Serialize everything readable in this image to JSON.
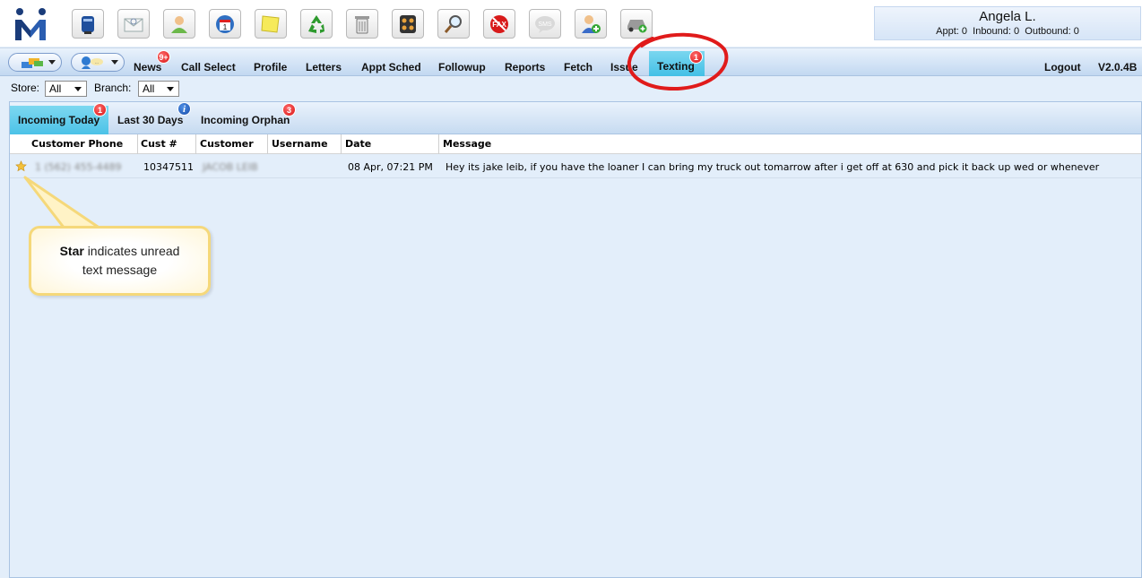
{
  "user": {
    "name": "Angela L.",
    "appt_label": "Appt:",
    "appt_value": "0",
    "inbound_label": "Inbound:",
    "inbound_value": "0",
    "outbound_label": "Outbound:",
    "outbound_value": "0"
  },
  "toolbar_icons": [
    "mailbox-icon",
    "email-icon",
    "person-icon",
    "calendar-icon",
    "sticky-note-icon",
    "recycle-icon",
    "trash-icon",
    "calculator-icon",
    "magnifier-icon",
    "no-fax-icon",
    "sms-icon",
    "add-user-icon",
    "car-add-icon"
  ],
  "toolbar_sms_text": "SMS",
  "toolbar_calendar_text": "1",
  "nav": {
    "items": [
      "News",
      "Call Select",
      "Profile",
      "Letters",
      "Appt Sched",
      "Followup",
      "Reports",
      "Fetch",
      "Issue"
    ],
    "active": "Texting",
    "news_badge": "9+",
    "texting_badge": "1",
    "logout": "Logout",
    "version": "V2.0.4B"
  },
  "filters": {
    "store_label": "Store:",
    "store_value": "All",
    "branch_label": "Branch:",
    "branch_value": "All"
  },
  "tabs": {
    "active": "Incoming Today",
    "active_badge": "1",
    "last30": "Last 30 Days",
    "last30_badge": "i",
    "orphan": "Incoming Orphan",
    "orphan_badge": "3"
  },
  "table": {
    "headers": [
      "Customer Phone",
      "Cust #",
      "Customer",
      "Username",
      "Date",
      "Message"
    ],
    "rows": [
      {
        "phone": "1 (562) 455-4489",
        "cust_num": "10347511",
        "customer": "JACOB LEIB",
        "username": "",
        "date": "08 Apr, 07:21 PM",
        "message": "Hey its jake leib, if you have the loaner I can bring my truck out tomarrow after i get off at 630 and pick it back up  wed or whenever"
      }
    ]
  },
  "callout": {
    "bold": "Star",
    "text_line1": "indicates unread",
    "text_line2": "text message"
  },
  "colors": {
    "accent_tab": "#4cc2e7",
    "badge_red": "#d81414",
    "annotation_red": "#e01b1b",
    "callout_border": "#f5d87a"
  }
}
